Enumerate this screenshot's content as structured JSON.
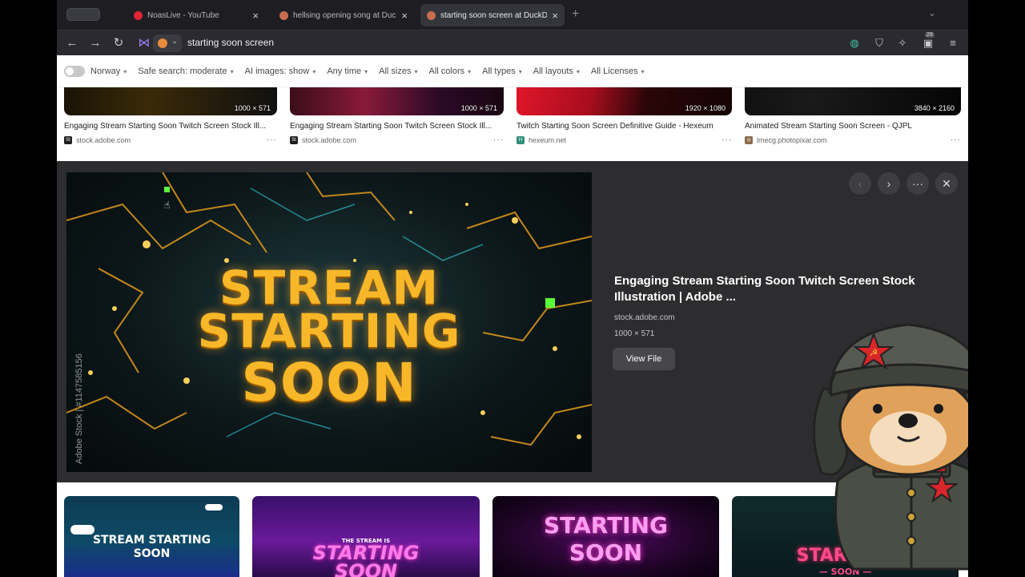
{
  "tabs": [
    {
      "title": "NoasLive - YouTube",
      "favicon_color": "#e0253a"
    },
    {
      "title": "hellsing opening song at DuckDuckGo",
      "favicon_color": "#c96d4e"
    },
    {
      "title": "starting soon screen at DuckDuckGo",
      "favicon_color": "#c96d4e",
      "active": true
    }
  ],
  "toolbar": {
    "address": "starting soon screen",
    "badge_count": "29"
  },
  "filters": {
    "region": "Norway",
    "items": [
      "Safe search: moderate",
      "AI images: show",
      "Any time",
      "All sizes",
      "All colors",
      "All types",
      "All layouts",
      "All Licenses"
    ]
  },
  "top_results": [
    {
      "caption": "Engaging Stream Starting Soon Twitch Screen Stock Ill...",
      "source": "stock.adobe.com",
      "dims": "1000 × 571",
      "icon_text": "St"
    },
    {
      "caption": "Engaging Stream Starting Soon Twitch Screen Stock Ill...",
      "source": "stock.adobe.com",
      "dims": "1000 × 571",
      "icon_text": "St"
    },
    {
      "caption": "Twitch Starting Soon Screen Definitive Guide - Hexeum",
      "source": "hexeum.net",
      "dims": "1920 × 1080",
      "icon_text": "H"
    },
    {
      "caption": "Animated Stream Starting Soon Screen - QJPL",
      "source": "lmecg.photopixar.com",
      "dims": "3840 × 2160",
      "icon_text": "◎"
    }
  ],
  "more_glyph": "···",
  "detail": {
    "hero_lines": [
      "STREAM",
      "STARTING",
      "SOON"
    ],
    "watermark": "Adobe Stock | #1147585156",
    "title": "Engaging Stream Starting Soon Twitch Screen Stock Illustration | Adobe ...",
    "source": "stock.adobe.com",
    "dims": "1000 × 571",
    "view_file": "View File"
  },
  "bottom_results": [
    {
      "lines": [
        "STREAM STARTING",
        "SOON"
      ]
    },
    {
      "lines": [
        "THE STREAM IS",
        "STARTING",
        "SOON"
      ]
    },
    {
      "lines": [
        "STARTING",
        "SOON"
      ]
    },
    {
      "lines": [
        "STARTING",
        "— SOON —"
      ]
    }
  ],
  "colors": {
    "accent_gold": "#f7b728",
    "detail_bg": "#2d2d2f",
    "neon_pink": "#ff5ad8"
  }
}
